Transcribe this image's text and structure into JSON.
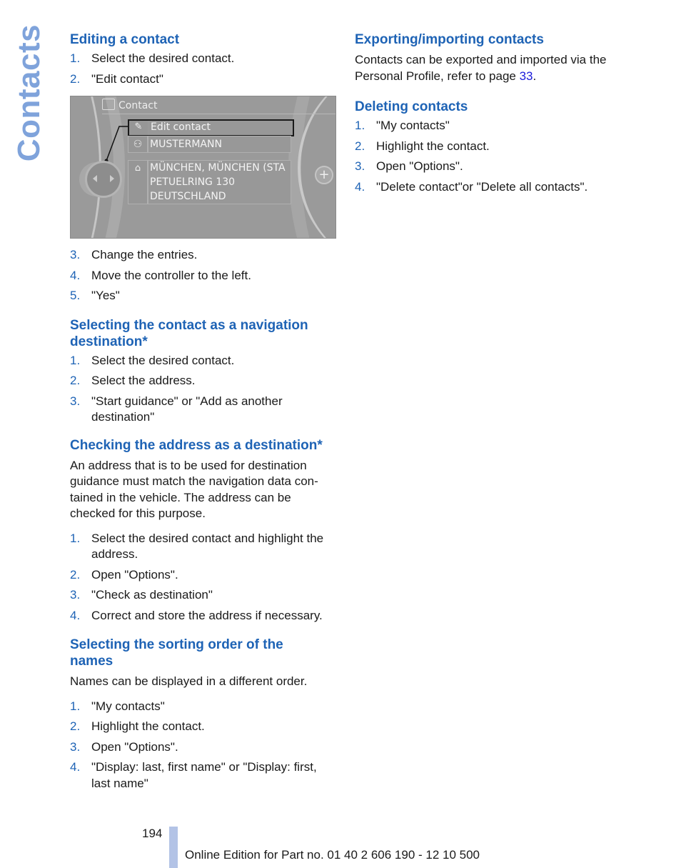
{
  "side_title": "Contacts",
  "left_column": {
    "editing": {
      "heading": "Editing a contact",
      "steps_before": [
        {
          "num": "1.",
          "text": "Select the desired contact."
        },
        {
          "num": "2.",
          "text": "\"Edit contact\""
        }
      ],
      "screenshot": {
        "header_icon": "contact-card-icon",
        "header_title": "Contact",
        "rows": [
          {
            "icon": "pencil-icon",
            "text": "Edit contact",
            "selected": true
          },
          {
            "icon": "person-icon",
            "text": "MUSTERMANN",
            "selected": false
          },
          {
            "icon": "address-icon",
            "lines": [
              "MÜNCHEN, MÜNCHEN (STA",
              "PETUELRING 130",
              "DEUTSCHLAND"
            ],
            "selected": false
          }
        ],
        "controller_icon": "controller-left-right-icon",
        "zoom_icon": "plus-icon"
      },
      "steps_after": [
        {
          "num": "3.",
          "text": "Change the entries."
        },
        {
          "num": "4.",
          "text": "Move the controller to the left."
        },
        {
          "num": "5.",
          "text": "\"Yes\""
        }
      ]
    },
    "nav_destination": {
      "heading": "Selecting the contact as a navigation destination*",
      "steps": [
        {
          "num": "1.",
          "text": "Select the desired contact."
        },
        {
          "num": "2.",
          "text": "Select the address."
        },
        {
          "num": "3.",
          "text": "\"Start guidance\" or \"Add as another destination\""
        }
      ]
    },
    "checking_address": {
      "heading": "Checking the address as a destination*",
      "body": "An address that is to be used for destination guidance must match the navigation data con-tained in the vehicle. The address can be checked for this purpose.",
      "steps": [
        {
          "num": "1.",
          "text": "Select the desired contact and highlight the address."
        },
        {
          "num": "2.",
          "text": "Open \"Options\"."
        },
        {
          "num": "3.",
          "text": "\"Check as destination\""
        },
        {
          "num": "4.",
          "text": "Correct and store the address if necessary."
        }
      ]
    },
    "sorting": {
      "heading": "Selecting the sorting order of the names",
      "body": "Names can be displayed in a different order.",
      "steps": [
        {
          "num": "1.",
          "text": "\"My contacts\""
        },
        {
          "num": "2.",
          "text": "Highlight the contact."
        },
        {
          "num": "3.",
          "text": "Open \"Options\"."
        },
        {
          "num": "4.",
          "text": "\"Display: last, first name\" or \"Display: first, last name\""
        }
      ]
    }
  },
  "right_column": {
    "export": {
      "heading": "Exporting/importing contacts",
      "body_before": "Contacts can be exported and imported via the Personal Profile, refer to page ",
      "page_link": "33",
      "body_after": "."
    },
    "deleting": {
      "heading": "Deleting contacts",
      "steps": [
        {
          "num": "1.",
          "text": "\"My contacts\""
        },
        {
          "num": "2.",
          "text": "Highlight the contact."
        },
        {
          "num": "3.",
          "text": "Open \"Options\"."
        },
        {
          "num": "4.",
          "text": "\"Delete contact\"or \"Delete all contacts\"."
        }
      ]
    }
  },
  "footer": {
    "page_number": "194",
    "edition": "Online Edition for Part no. 01 40 2 606 190 - 12 10 500"
  },
  "colors": {
    "heading": "#1e63b5",
    "side_title": "#7fa3db",
    "link": "#1a1adb",
    "footer_bar": "#b3c3e6"
  }
}
